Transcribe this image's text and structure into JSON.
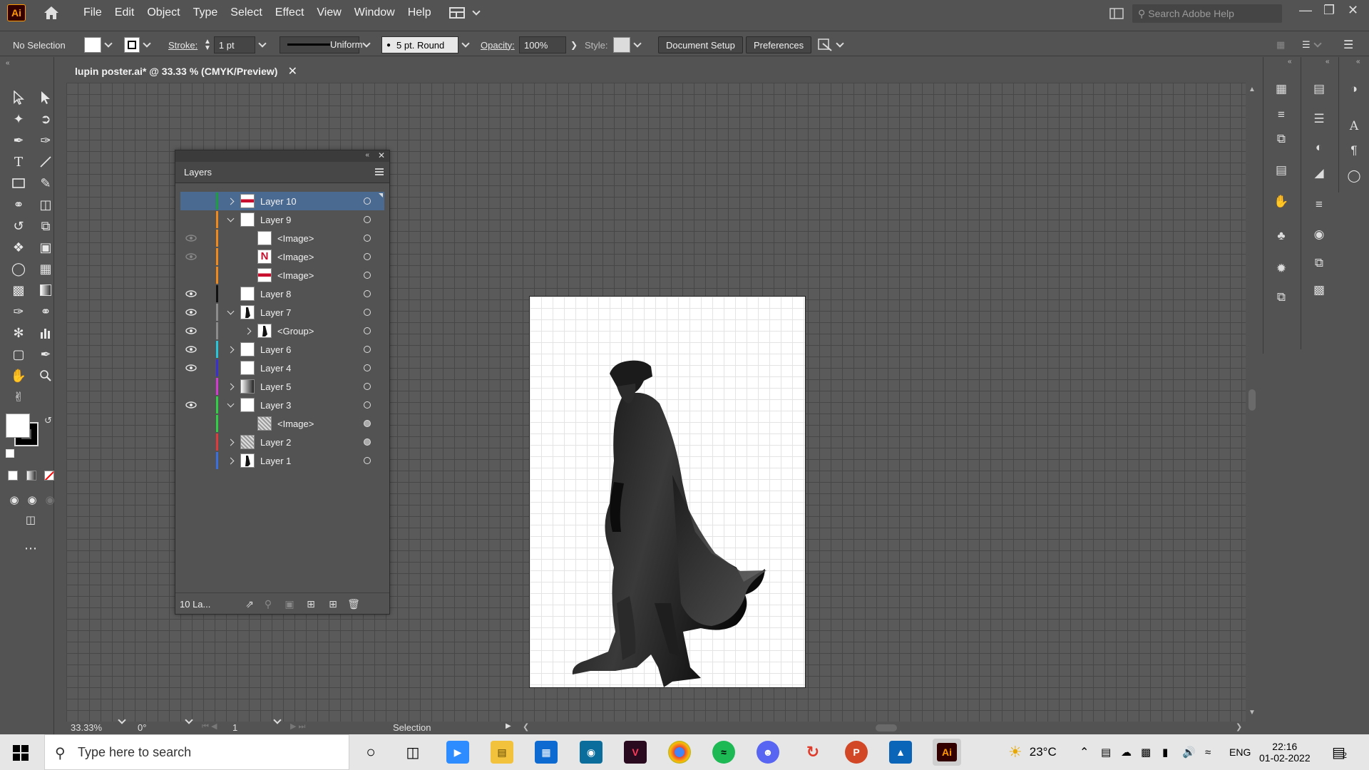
{
  "app": {
    "logo": "Ai",
    "menu": [
      "File",
      "Edit",
      "Object",
      "Type",
      "Select",
      "Effect",
      "View",
      "Window",
      "Help"
    ],
    "help_search_placeholder": "Search Adobe Help"
  },
  "control_bar": {
    "selection_label": "No Selection",
    "stroke_label": "Stroke:",
    "stroke_weight": "1 pt",
    "stroke_profile": "Uniform",
    "brush": "5 pt. Round",
    "opacity_label": "Opacity:",
    "opacity_value": "100%",
    "style_label": "Style:",
    "document_setup": "Document Setup",
    "preferences": "Preferences"
  },
  "document": {
    "tab_title": "lupin poster.ai* @ 33.33 % (CMYK/Preview)"
  },
  "status_bar": {
    "zoom": "33.33%",
    "rotation": "0°",
    "artboard_number": "1",
    "active_tool": "Selection"
  },
  "layers_panel": {
    "title": "Layers",
    "footer_count": "10 La...",
    "rows": [
      {
        "name": "Layer 10",
        "visible": false,
        "expand": "collapsed",
        "indent": 0,
        "color": "#1f9e3f",
        "selected": true,
        "target": "hollow",
        "thumb": "netflix-text"
      },
      {
        "name": "Layer 9",
        "visible": false,
        "expand": "expanded",
        "indent": 0,
        "color": "#f08a1c",
        "selected": false,
        "target": "hollow",
        "thumb": "white"
      },
      {
        "name": "<Image>",
        "visible": "dim",
        "expand": "none",
        "indent": 1,
        "color": "#f08a1c",
        "selected": false,
        "target": "hollow",
        "thumb": "white"
      },
      {
        "name": "<Image>",
        "visible": "dim",
        "expand": "none",
        "indent": 1,
        "color": "#f08a1c",
        "selected": false,
        "target": "hollow",
        "thumb": "netflix-n"
      },
      {
        "name": "<Image>",
        "visible": false,
        "expand": "none",
        "indent": 1,
        "color": "#f08a1c",
        "selected": false,
        "target": "hollow",
        "thumb": "netflix-text"
      },
      {
        "name": "Layer 8",
        "visible": true,
        "expand": "none",
        "indent": 0,
        "color": "#111111",
        "selected": false,
        "target": "hollow",
        "thumb": "white"
      },
      {
        "name": "Layer 7",
        "visible": true,
        "expand": "expanded",
        "indent": 0,
        "color": "#8c8c8c",
        "selected": false,
        "target": "hollow",
        "thumb": "silhouette"
      },
      {
        "name": "<Group>",
        "visible": true,
        "expand": "collapsed",
        "indent": 1,
        "color": "#8c8c8c",
        "selected": false,
        "target": "hollow",
        "thumb": "silhouette"
      },
      {
        "name": "Layer 6",
        "visible": true,
        "expand": "collapsed",
        "indent": 0,
        "color": "#27c6d8",
        "selected": false,
        "target": "hollow",
        "thumb": "white"
      },
      {
        "name": "Layer 4",
        "visible": true,
        "expand": "none",
        "indent": 0,
        "color": "#3a2fd0",
        "selected": false,
        "target": "hollow",
        "thumb": "white"
      },
      {
        "name": "Layer 5",
        "visible": false,
        "expand": "collapsed",
        "indent": 0,
        "color": "#d23ad0",
        "selected": false,
        "target": "hollow",
        "thumb": "gradient"
      },
      {
        "name": "Layer 3",
        "visible": true,
        "expand": "expanded",
        "indent": 0,
        "color": "#2fd043",
        "selected": false,
        "target": "hollow",
        "thumb": "white"
      },
      {
        "name": "<Image>",
        "visible": false,
        "expand": "none",
        "indent": 1,
        "color": "#2fd043",
        "selected": false,
        "target": "filled",
        "thumb": "texture"
      },
      {
        "name": "Layer 2",
        "visible": false,
        "expand": "collapsed",
        "indent": 0,
        "color": "#e03a3a",
        "selected": false,
        "target": "filled",
        "thumb": "texture"
      },
      {
        "name": "Layer 1",
        "visible": false,
        "expand": "collapsed",
        "indent": 0,
        "color": "#3a6fe0",
        "selected": false,
        "target": "hollow",
        "thumb": "silhouette"
      }
    ]
  },
  "taskbar": {
    "search_placeholder": "Type here to search",
    "weather_temp": "23°C",
    "language": "ENG",
    "time": "22:16",
    "date": "01-02-2022",
    "notification_count": "2"
  },
  "colors": {
    "panel_bg": "#535353",
    "selection_blue": "#4b6a91",
    "ai_orange": "#ff9a00"
  }
}
